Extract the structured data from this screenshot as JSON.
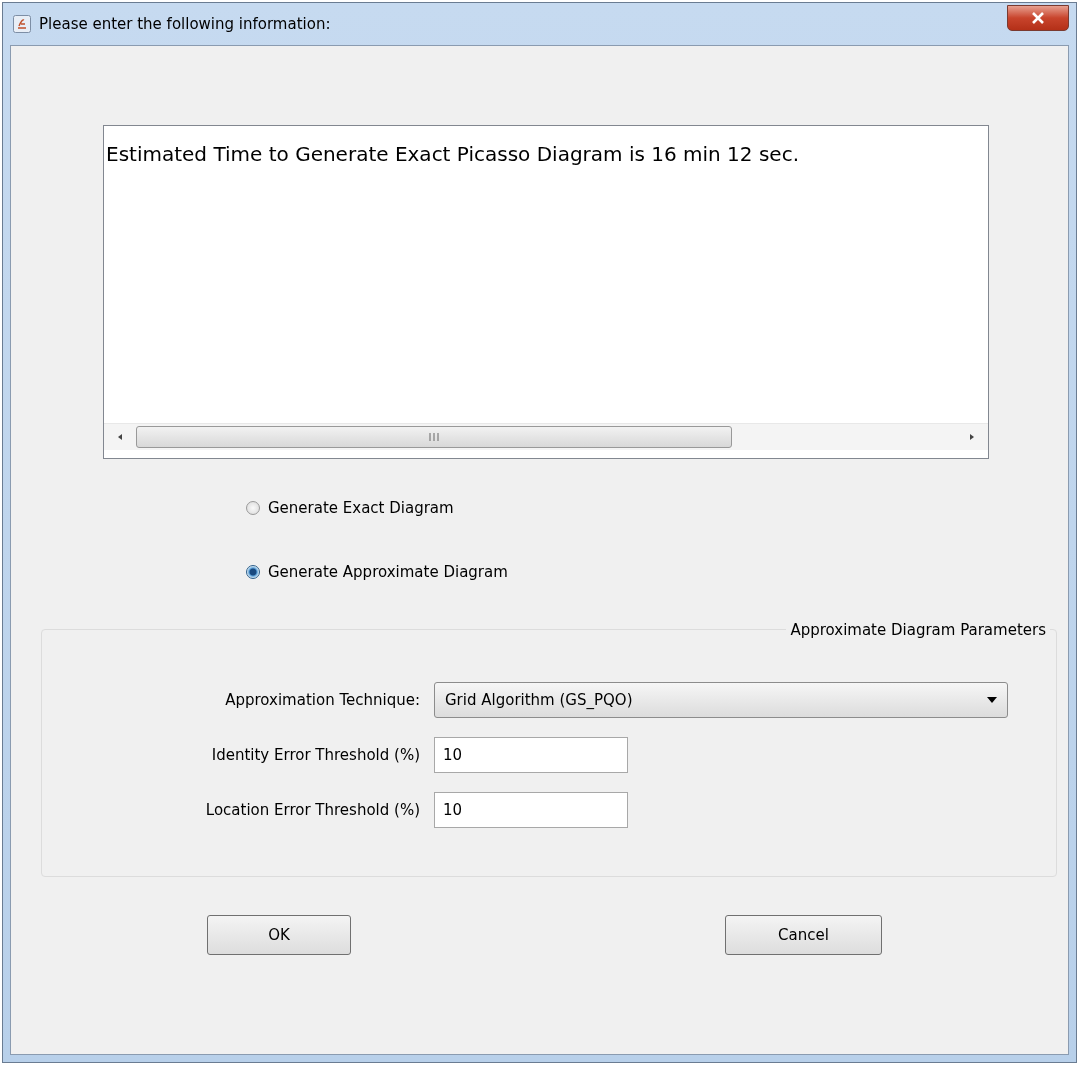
{
  "window": {
    "title": "Please enter the following information:"
  },
  "message": "Estimated Time to Generate Exact Picasso Diagram is 16 min 12 sec.",
  "options": [
    {
      "label": "Generate Exact Diagram",
      "selected": false
    },
    {
      "label": "Generate Approximate Diagram",
      "selected": true
    }
  ],
  "parameters": {
    "title": "Approximate Diagram Parameters",
    "fields": [
      {
        "kind": "dropdown",
        "label": "Approximation Technique:",
        "value": "Grid Algorithm (GS_PQO)"
      },
      {
        "kind": "text",
        "label": "Identity Error Threshold (%)",
        "value": "10"
      },
      {
        "kind": "text",
        "label": "Location Error Threshold (%)",
        "value": "10"
      }
    ]
  },
  "buttons": [
    "OK",
    "Cancel"
  ]
}
